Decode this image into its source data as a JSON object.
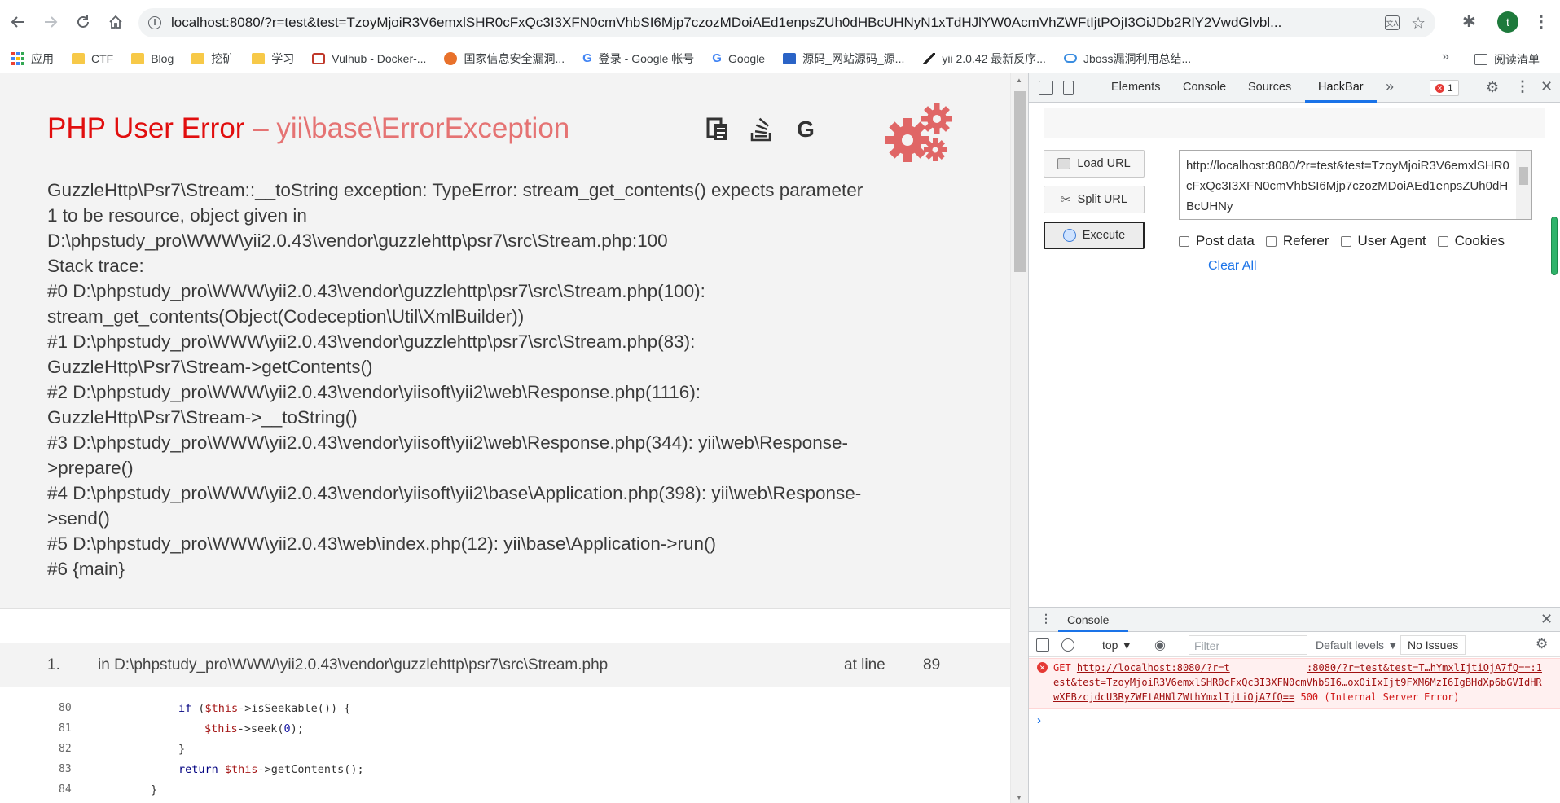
{
  "browser": {
    "url_host": "localhost",
    "url_rest": ":8080/?r=test&test=TzoyMjoiR3V6emxlSHR0cFxQc3I3XFN0cmVhbSI6Mjp7czozMDoiAEd1enpsZUh0dHBcUHNyN1xTdHJlYW0AcmVhZWFtIjtPOjI3OiJDb2RlY2VwdGlvbl...",
    "avatar_letter": "t"
  },
  "bookmarks": [
    {
      "label": "应用",
      "icon": "apps-grid-icon"
    },
    {
      "label": "CTF",
      "icon": "folder-icon"
    },
    {
      "label": "Blog",
      "icon": "folder-icon"
    },
    {
      "label": "挖矿",
      "icon": "folder-icon"
    },
    {
      "label": "学习",
      "icon": "folder-icon"
    },
    {
      "label": "Vulhub - Docker-...",
      "icon": "vulhub-icon"
    },
    {
      "label": "国家信息安全漏洞...",
      "icon": "firefox-icon"
    },
    {
      "label": "登录 - Google 帐号",
      "icon": "google-icon"
    },
    {
      "label": "Google",
      "icon": "google-icon"
    },
    {
      "label": "源码_网站源码_源...",
      "icon": "source-icon"
    },
    {
      "label": "yii 2.0.42 最新反序...",
      "icon": "yii-icon"
    },
    {
      "label": "Jboss漏洞利用总结...",
      "icon": "cloud-icon"
    }
  ],
  "bookmarks_more": "»",
  "reading_list": "阅读清单",
  "error": {
    "title_prefix": "PHP User Error",
    "title_sep": " – ",
    "title_class": "yii\\base\\ErrorException",
    "message_lines": [
      "GuzzleHttp\\Psr7\\Stream::__toString exception: TypeError: stream_get_contents() expects parameter",
      "1 to be resource, object given in",
      "D:\\phpstudy_pro\\WWW\\yii2.0.43\\vendor\\guzzlehttp\\psr7\\src\\Stream.php:100",
      "Stack trace:",
      "#0 D:\\phpstudy_pro\\WWW\\yii2.0.43\\vendor\\guzzlehttp\\psr7\\src\\Stream.php(100):",
      "stream_get_contents(Object(Codeception\\Util\\XmlBuilder))",
      "#1 D:\\phpstudy_pro\\WWW\\yii2.0.43\\vendor\\guzzlehttp\\psr7\\src\\Stream.php(83):",
      "GuzzleHttp\\Psr7\\Stream->getContents()",
      "#2 D:\\phpstudy_pro\\WWW\\yii2.0.43\\vendor\\yiisoft\\yii2\\web\\Response.php(1116):",
      "GuzzleHttp\\Psr7\\Stream->__toString()",
      "#3 D:\\phpstudy_pro\\WWW\\yii2.0.43\\vendor\\yiisoft\\yii2\\web\\Response.php(344): yii\\web\\Response-",
      ">prepare()",
      "#4 D:\\phpstudy_pro\\WWW\\yii2.0.43\\vendor\\yiisoft\\yii2\\base\\Application.php(398): yii\\web\\Response-",
      ">send()",
      "#5 D:\\phpstudy_pro\\WWW\\yii2.0.43\\web\\index.php(12): yii\\base\\Application->run()",
      "#6 {main}"
    ]
  },
  "call_stack": {
    "num": "1.",
    "file": "in D:\\phpstudy_pro\\WWW\\yii2.0.43\\vendor\\guzzlehttp\\psr7\\src\\Stream.php",
    "at_label": "at line",
    "line": "89"
  },
  "code_lines": [
    {
      "ln": "80",
      "indent": 1,
      "parts": [
        [
          "kw",
          "if "
        ],
        [
          "",
          "("
        ],
        [
          "var",
          "$this"
        ],
        [
          "",
          "->isSeekable()) {"
        ]
      ]
    },
    {
      "ln": "81",
      "indent": 2,
      "parts": [
        [
          "var",
          "$this"
        ],
        [
          "",
          "->seek("
        ],
        [
          "num-lit",
          "0"
        ],
        [
          "",
          ");"
        ]
      ]
    },
    {
      "ln": "82",
      "indent": 1,
      "parts": [
        [
          "",
          "}"
        ]
      ]
    },
    {
      "ln": "83",
      "indent": 1,
      "parts": [
        [
          "kw",
          "return "
        ],
        [
          "var",
          "$this"
        ],
        [
          "",
          "->getContents();"
        ]
      ]
    },
    {
      "ln": "84",
      "indent": 0,
      "parts": [
        [
          "",
          "}"
        ]
      ]
    }
  ],
  "devtools": {
    "tabs": [
      "Elements",
      "Console",
      "Sources",
      "HackBar"
    ],
    "more": "»",
    "error_count": "1",
    "hackbar": {
      "load_url": "Load URL",
      "split_url": "Split URL",
      "execute": "Execute",
      "url_value": "http://localhost:8080/?r=test&test=TzoyMjoiR3V6emxlSHR0cFxQc3I3XFN0cmVhbSI6Mjp7czozMDoiAEd1enpsZUh0dHBcUHNy",
      "checks": [
        "Post data",
        "Referer",
        "User Agent",
        "Cookies"
      ],
      "clear_all": "Clear All"
    },
    "drawer": {
      "tab": "Console",
      "context": "top ▼",
      "filter_placeholder": "Filter",
      "levels": "Default levels ▼",
      "issues": "No Issues",
      "error_method": "GET ",
      "error_link1": "http://localhost:8080/?r=t",
      "error_link2": ":8080/?r=test&test=T…hYmxlIjtiOjA7fQ==:1",
      "error_link3": "est&test=TzoyMjoiR3V6emxlSHR0cFxQc3I3XFN0cmVhbSI6…oxOiIxIjt9FXM6MzI6IgBHdXp6bGVIdHRwXFBzcjdcU3RyZWFtAHNlZWthYmxlIjtiOjA7fQ==",
      "error_status": " 500 (Internal Server Error)",
      "prompt": "›"
    }
  }
}
